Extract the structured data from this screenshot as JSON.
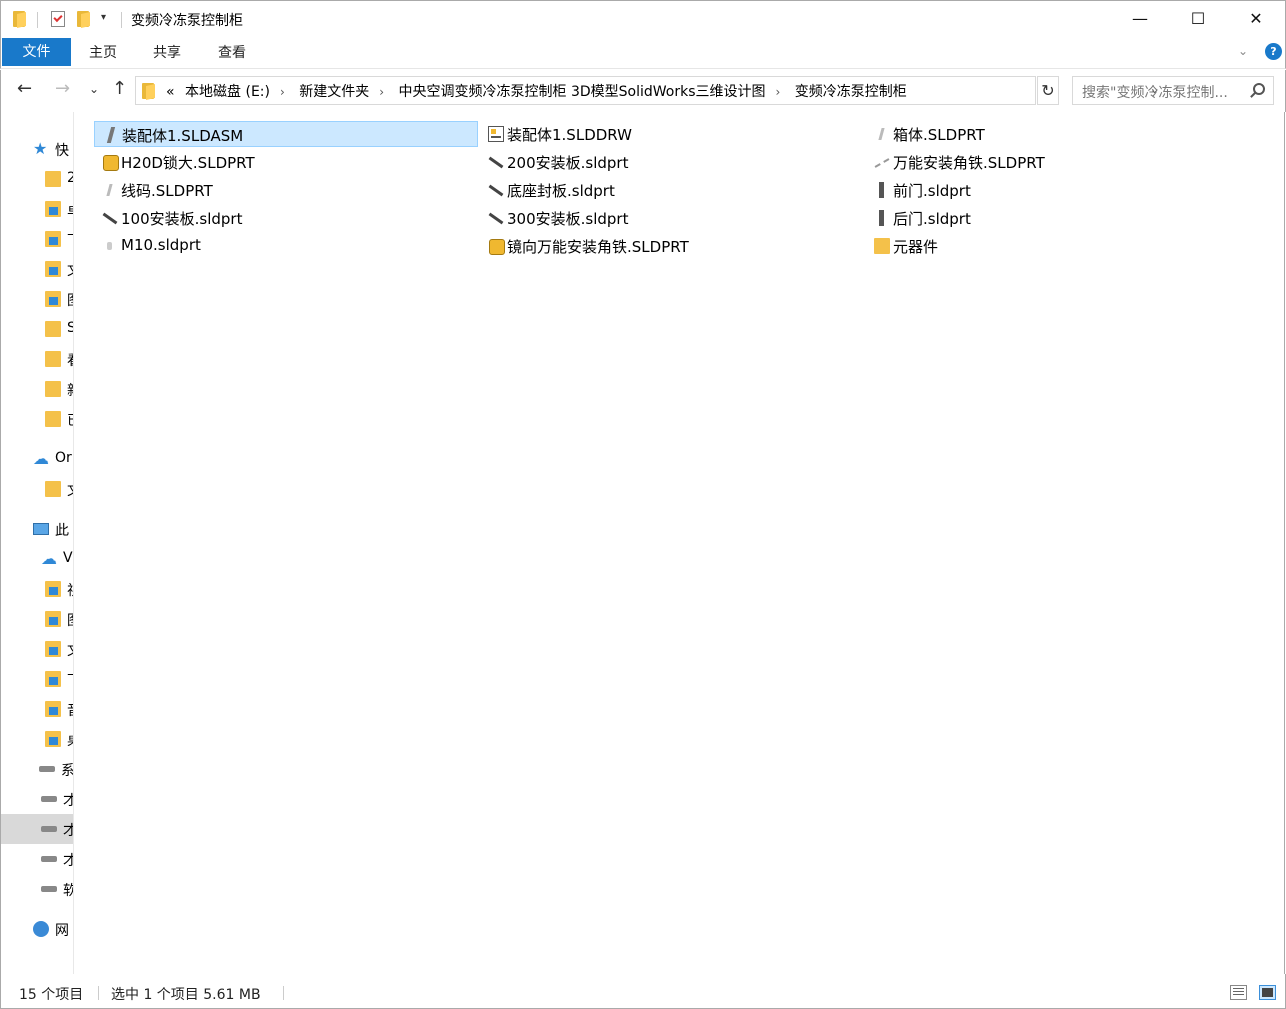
{
  "window": {
    "title": "变频冷冻泵控制柜",
    "minimize_glyph": "—",
    "maximize_glyph": "☐",
    "close_glyph": "✕"
  },
  "ribbon": {
    "tabs": [
      "文件",
      "主页",
      "共享",
      "查看"
    ],
    "expand_glyph": "⌄",
    "help_glyph": "?"
  },
  "address_bar": {
    "overflow_glyph": "«",
    "crumbs": [
      "本地磁盘 (E:)",
      "新建文件夹",
      "中央空调变频冷冻泵控制柜 3D模型SolidWorks三维设计图",
      "变频冷冻泵控制柜"
    ],
    "separator_glyph": "›",
    "dropdown_glyph": "⌄",
    "refresh_glyph": "↻"
  },
  "search": {
    "placeholder": "搜索\"变频冷冻泵控制..."
  },
  "nav_buttons": {
    "back": "←",
    "forward": "→",
    "recent": "⌄",
    "up": "↑"
  },
  "nav_pane": {
    "items": [
      {
        "label": "快",
        "icon": "star-icon"
      },
      {
        "label": "2",
        "icon": "folder-icon"
      },
      {
        "label": "卓",
        "icon": "desktop-folder-icon"
      },
      {
        "label": "下",
        "icon": "downloads-folder-icon"
      },
      {
        "label": "文",
        "icon": "documents-folder-icon"
      },
      {
        "label": "图",
        "icon": "pictures-folder-icon"
      },
      {
        "label": "S",
        "icon": "folder-icon"
      },
      {
        "label": "看",
        "icon": "folder-icon"
      },
      {
        "label": "新",
        "icon": "folder-icon"
      },
      {
        "label": "已",
        "icon": "folder-icon"
      },
      {
        "label": "Or",
        "icon": "onedrive-cloud-icon"
      },
      {
        "label": "文",
        "icon": "folder-icon"
      },
      {
        "label": "此",
        "icon": "this-pc-icon"
      },
      {
        "label": "V",
        "icon": "cloud-icon"
      },
      {
        "label": "视",
        "icon": "videos-folder-icon"
      },
      {
        "label": "图",
        "icon": "pictures-folder-icon"
      },
      {
        "label": "文",
        "icon": "documents-folder-icon"
      },
      {
        "label": "下",
        "icon": "downloads-folder-icon"
      },
      {
        "label": "音",
        "icon": "music-folder-icon"
      },
      {
        "label": "桌",
        "icon": "desktop-folder-icon"
      },
      {
        "label": "系",
        "icon": "windows-drive-icon"
      },
      {
        "label": "才",
        "icon": "drive-icon"
      },
      {
        "label": "才",
        "icon": "drive-icon"
      },
      {
        "label": "才",
        "icon": "drive-icon"
      },
      {
        "label": "软",
        "icon": "drive-icon"
      },
      {
        "label": "网",
        "icon": "network-icon"
      }
    ]
  },
  "files": [
    {
      "name": "装配体1.SLDASM",
      "icon": "fi-part",
      "icon_name": "solidworks-assembly-icon",
      "selected": true
    },
    {
      "name": "H20D锁大.SLDPRT",
      "icon": "fi-asm",
      "icon_name": "solidworks-part-icon"
    },
    {
      "name": "线码.SLDPRT",
      "icon": "fi-light",
      "icon_name": "solidworks-part-icon"
    },
    {
      "name": "100安装板.sldprt",
      "icon": "fi-plate",
      "icon_name": "solidworks-part-icon"
    },
    {
      "name": "M10.sldprt",
      "icon": "fi-screw",
      "icon_name": "solidworks-part-icon"
    },
    {
      "name": "装配体1.SLDDRW",
      "icon": "fi-drw",
      "icon_name": "solidworks-drawing-icon"
    },
    {
      "name": "200安装板.sldprt",
      "icon": "fi-plate",
      "icon_name": "solidworks-part-icon"
    },
    {
      "name": "底座封板.sldprt",
      "icon": "fi-plate",
      "icon_name": "solidworks-part-icon"
    },
    {
      "name": "300安装板.sldprt",
      "icon": "fi-plate",
      "icon_name": "solidworks-part-icon"
    },
    {
      "name": "镜向万能安装角铁.SLDPRT",
      "icon": "fi-asm",
      "icon_name": "solidworks-part-icon"
    },
    {
      "name": "箱体.SLDPRT",
      "icon": "fi-light",
      "icon_name": "solidworks-part-icon"
    },
    {
      "name": "万能安装角铁.SLDPRT",
      "icon": "fi-dashed",
      "icon_name": "solidworks-part-icon"
    },
    {
      "name": "前门.sldprt",
      "icon": "fi-door",
      "icon_name": "solidworks-part-icon"
    },
    {
      "name": "后门.sldprt",
      "icon": "fi-door",
      "icon_name": "solidworks-part-icon"
    },
    {
      "name": "元器件",
      "icon": "fi-folder",
      "icon_name": "folder-icon"
    }
  ],
  "status": {
    "item_count": "15 个项目",
    "selection": "选中 1 个项目  5.61 MB"
  }
}
